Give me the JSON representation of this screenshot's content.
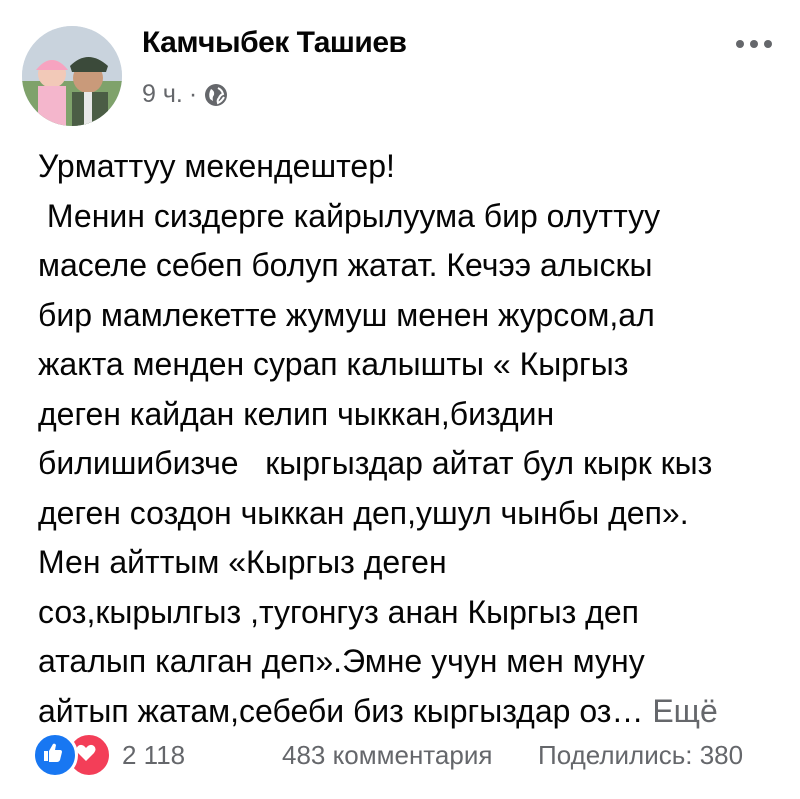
{
  "post": {
    "author": "Камчыбек Ташиев",
    "time": "9 ч.",
    "separator": "·",
    "audience_icon": "globe-icon",
    "more_icon": "more-dots-icon",
    "text_lines": [
      "Урматтуу мекендештер!",
      " Менин сиздерге кайрылуума бир олуттуу",
      "маселе себеп болуп жатат. Кечээ алыскы",
      "бир мамлекетте жумуш менен журсом,ал",
      "жакта менден сурап калышты « Кыргыз",
      "деген кайдан келип чыккан,биздин",
      "билишибизче   кыргыздар айтат бул кырк кыз",
      "деген создон чыккан деп,ушул чынбы деп».",
      "Мен айттым «Кыргыз деген",
      "соз,кырылгыз ,тугонгуз анан Кыргыз деп",
      "аталып калган деп».Эмне учун мен муну"
    ],
    "last_line": "айтып жатам,себеби биз кыргыздар оз…",
    "see_more": "Ещё"
  },
  "footer": {
    "reaction_icons": [
      "like-icon",
      "love-icon"
    ],
    "reaction_count": "2 118",
    "comments": "483 комментария",
    "shares": "Поделились: 380"
  },
  "colors": {
    "text": "#050505",
    "secondary": "#65676b",
    "like": "#1877f2",
    "love": "#f33e58"
  }
}
